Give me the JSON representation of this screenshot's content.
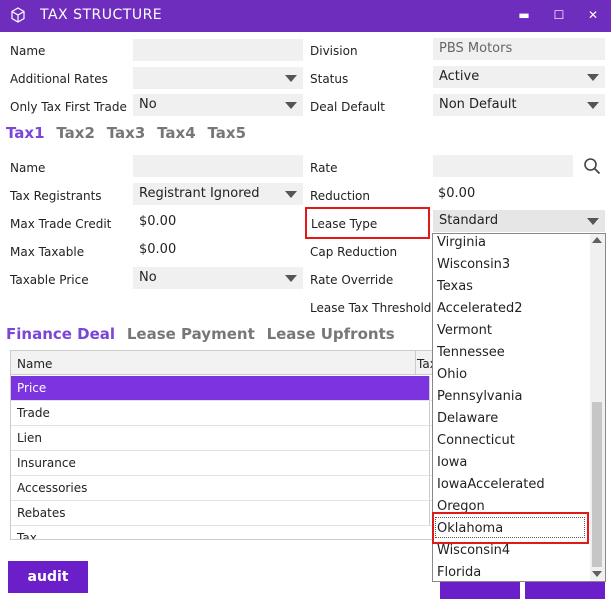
{
  "window": {
    "title": "TAX STRUCTURE",
    "minimize": "▬",
    "maximize": "☐",
    "close": "✕"
  },
  "general": {
    "name_label": "Name",
    "name_value": "",
    "division_label": "Division",
    "division_value": "PBS Motors",
    "additional_rates_label": "Additional Rates",
    "additional_rates_value": "",
    "status_label": "Status",
    "status_value": "Active",
    "only_first_trade_label": "Only Tax First Trade",
    "only_first_trade_value": "No",
    "deal_default_label": "Deal Default",
    "deal_default_value": "Non Default"
  },
  "tax_tabs": [
    "Tax1",
    "Tax2",
    "Tax3",
    "Tax4",
    "Tax5"
  ],
  "tax": {
    "name_label": "Name",
    "name_value": "",
    "rate_label": "Rate",
    "rate_value": "",
    "registrants_label": "Tax Registrants",
    "registrants_value": "Registrant Ignored",
    "reduction_label": "Reduction",
    "reduction_value": "$0.00",
    "max_trade_credit_label": "Max Trade Credit",
    "max_trade_credit_value": "$0.00",
    "lease_type_label": "Lease Type",
    "lease_type_value": "Standard",
    "max_taxable_label": "Max Taxable",
    "max_taxable_value": "$0.00",
    "cap_reduction_label": "Cap Reduction",
    "taxable_price_label": "Taxable Price",
    "taxable_price_value": "No",
    "rate_override_label": "Rate Override",
    "lease_tax_threshold_label": "Lease Tax Threshold"
  },
  "section_tabs": [
    "Finance Deal",
    "Lease Payment",
    "Lease Upfronts"
  ],
  "grid": {
    "col_name": "Name",
    "col_tax": "Tax",
    "rows": [
      "Price",
      "Trade",
      "Lien",
      "Insurance",
      "Accessories",
      "Rebates",
      "Tax"
    ]
  },
  "lease_type_options": [
    "Virginia",
    "Wisconsin3",
    "Texas",
    "Accelerated2",
    "Vermont",
    "Tennessee",
    "Ohio",
    "Pennsylvania",
    "Delaware",
    "Connecticut",
    "Iowa",
    "IowaAccelerated",
    "Oregon",
    "Oklahoma",
    "Wisconsin4",
    "Florida"
  ],
  "highlighted_option": "Oklahoma",
  "audit_label": "audit",
  "colors": {
    "accent": "#6f2dbd",
    "selected_row": "#7b34e0",
    "highlight": "#e01919"
  }
}
